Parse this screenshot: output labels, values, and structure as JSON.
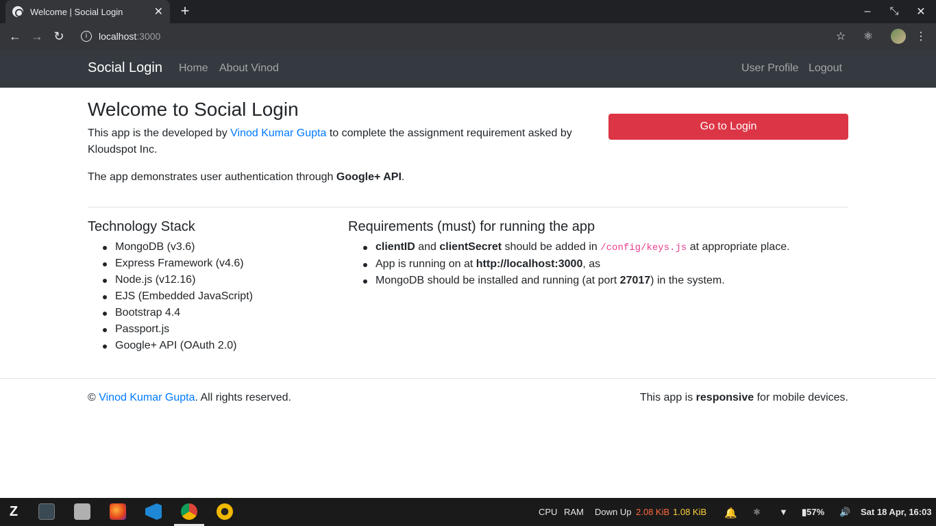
{
  "browser": {
    "tab_title": "Welcome | Social Login",
    "tab_close": "✕",
    "new_tab": "+",
    "url_host": "localhost",
    "url_port": ":3000",
    "window_controls": [
      "–",
      "⤡",
      "✕"
    ]
  },
  "site": {
    "brand": "Social Login",
    "nav_left": [
      "Home",
      "About Vinod"
    ],
    "nav_right": [
      "User Profile",
      "Logout"
    ]
  },
  "hero": {
    "heading": "Welcome to Social Login",
    "intro_prefix": "This app is the developed by ",
    "author": "Vinod Kumar Gupta",
    "intro_suffix": " to complete the assignment requirement asked by Kloudspot Inc.",
    "demo_prefix": "The app demonstrates user authentication through ",
    "demo_bold": "Google+ API",
    "demo_suffix": ".",
    "login_button": "Go to Login",
    "login_button_color": "#dc3545"
  },
  "tech": {
    "heading": "Technology Stack",
    "items": [
      "MongoDB (v3.6)",
      "Express Framework (v4.6)",
      "Node.js (v12.16)",
      "EJS (Embedded JavaScript)",
      "Bootstrap 4.4",
      "Passport.js",
      "Google+ API (OAuth 2.0)"
    ]
  },
  "requirements": {
    "heading": "Requirements (must) for running the app",
    "r1_b1": "clientID",
    "r1_t1": " and ",
    "r1_b2": "clientSecret",
    "r1_t2": " should be added in ",
    "r1_code": "/config/keys.js",
    "r1_t3": " at appropriate place.",
    "r2_t1": "App is running on at ",
    "r2_b1": "http://localhost:3000",
    "r2_t2": ", as",
    "r3_t1": "MongoDB should be installed and running (at port ",
    "r3_b1": "27017",
    "r3_t2": ") in the system."
  },
  "footer": {
    "copy_prefix": "© ",
    "author": "Vinod Kumar Gupta",
    "copy_suffix": ". All rights reserved.",
    "resp_prefix": "This app is ",
    "resp_bold": "responsive",
    "resp_suffix": " for mobile devices."
  },
  "taskbar": {
    "cpu": "CPU",
    "ram": "RAM",
    "net_label": "Down Up",
    "down": "2.08 KiB",
    "up": "1.08 KiB",
    "battery": "57%",
    "clock": "Sat 18 Apr, 16:03"
  }
}
